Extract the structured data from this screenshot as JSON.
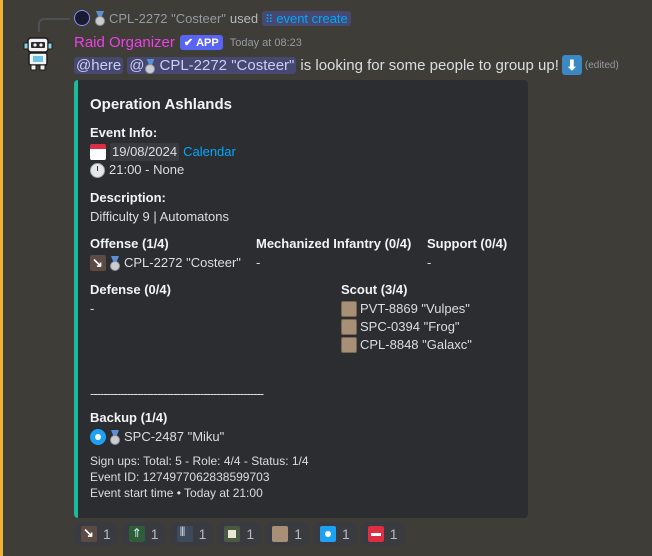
{
  "colors": {
    "highlight": "#f0b232",
    "bot_name": "#ee40e9",
    "embed_accent": "#1abc9c",
    "link": "#00a8fc",
    "app_badge": "#5865f2"
  },
  "reply": {
    "name": "CPL-2272 \"Costeer\"",
    "used_text": "used",
    "command": "event create"
  },
  "message": {
    "author": "Raid Organizer",
    "badge": "APP",
    "timestamp": "Today at 08:23",
    "mention_here": "@here",
    "mention_user": "@",
    "mention_user_name": "CPL-2272 \"Costeer\"",
    "text": "is looking for some people to group up!",
    "edited": "(edited)"
  },
  "embed": {
    "title": "Operation Ashlands",
    "event_info_label": "Event Info:",
    "date": "19/08/2024",
    "calendar_link": "Calendar",
    "time": "21:00",
    "time_suffix": "- None",
    "description_label": "Description:",
    "description": "Difficulty 9 | Automatons",
    "offense_label": "Offense (1/4)",
    "offense_member": "CPL-2272 \"Costeer\"",
    "infantry_label": "Mechanized Infantry (0/4)",
    "infantry_value": "-",
    "support_label": "Support (0/4)",
    "support_value": "-",
    "defense_label": "Defense (0/4)",
    "defense_value": "-",
    "scout_label": "Scout (3/4)",
    "scout_members": [
      "PVT-8869 \"Vulpes\"",
      "SPC-0394 \"Frog\"",
      "CPL-8848 \"Galaxc\""
    ],
    "separator": "----------------------------------------------------",
    "backup_label": "Backup (1/4)",
    "backup_member": "SPC-2487 \"Miku\"",
    "signups": "Sign ups: Total: 5 - Role: 4/4 - Status: 1/4",
    "event_id": "Event ID: 1274977062838599703",
    "start_time": "Event start time • Today at 21:00"
  },
  "reactions": [
    {
      "icon": "offense-icon",
      "count": "1"
    },
    {
      "icon": "mechanized-infantry-icon",
      "count": "1"
    },
    {
      "icon": "support-icon",
      "count": "1"
    },
    {
      "icon": "defense-icon",
      "count": "1"
    },
    {
      "icon": "scout-icon",
      "count": "1"
    },
    {
      "icon": "backup-icon",
      "count": "1"
    },
    {
      "icon": "no-entry-icon",
      "count": "1"
    }
  ]
}
